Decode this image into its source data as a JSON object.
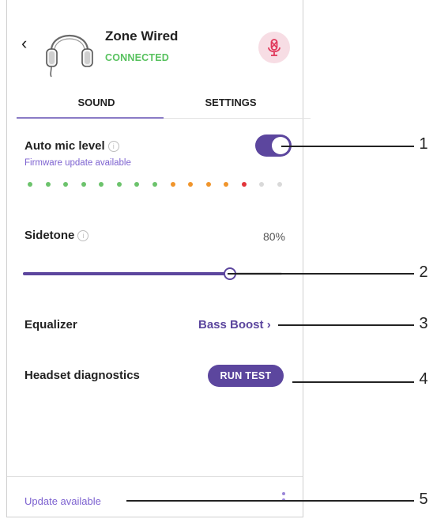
{
  "header": {
    "back_glyph": "‹",
    "device_name": "Zone Wired",
    "connection_status": "CONNECTED",
    "mic_icon": "mic-muted-icon"
  },
  "tabs": [
    {
      "label": "SOUND",
      "active": true
    },
    {
      "label": "SETTINGS",
      "active": false
    }
  ],
  "auto_mic": {
    "label": "Auto mic level",
    "info_glyph": "i",
    "note": "Firmware update available",
    "enabled": true,
    "level_dots": [
      "#6cc36c",
      "#6cc36c",
      "#6cc36c",
      "#6cc36c",
      "#6cc36c",
      "#6cc36c",
      "#6cc36c",
      "#6cc36c",
      "#f0952c",
      "#f0952c",
      "#f0952c",
      "#f0952c",
      "#e2353a",
      "#d9d9d9",
      "#d9d9d9"
    ]
  },
  "sidetone": {
    "label": "Sidetone",
    "info_glyph": "i",
    "value_text": "80%",
    "level": 0.8
  },
  "equalizer": {
    "label": "Equalizer",
    "value": "Bass Boost ›"
  },
  "diagnostics": {
    "label": "Headset diagnostics",
    "button": "RUN TEST"
  },
  "footer": {
    "update_text": "Update available",
    "menu_icon": "more-vertical-icon"
  },
  "callouts": [
    "1",
    "2",
    "3",
    "4",
    "5"
  ],
  "colors": {
    "accent": "#5c469e",
    "accent_light": "#7d62d0",
    "connected": "#58c25f",
    "mic_bg": "#f7dde4",
    "mic_icon": "#e0385a"
  }
}
